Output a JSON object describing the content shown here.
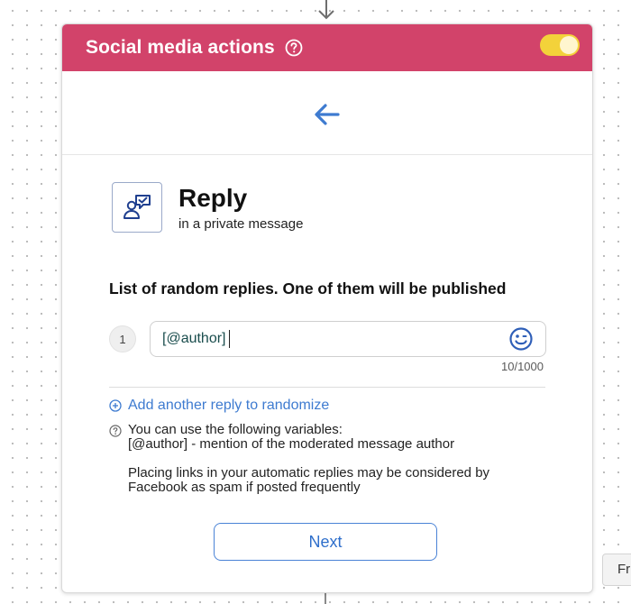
{
  "header": {
    "title": "Social media actions",
    "toggle_on": true,
    "color": "#d2436a",
    "toggle_color": "#f3d23a"
  },
  "nav": {
    "back_icon": "arrow-left-icon"
  },
  "action": {
    "title": "Reply",
    "subtitle": "in a private message",
    "icon": "person-chat-icon"
  },
  "replies": {
    "section_title": "List of random replies. One of them will be published",
    "items": [
      {
        "number": "1",
        "value": "[@author]"
      }
    ],
    "char_count": "10/1000",
    "add_label": "Add another reply to randomize"
  },
  "info": {
    "line1": "You can use the following variables:",
    "line2": "[@author] - mention of the moderated message author",
    "line3": "Placing links in your automatic replies may be considered by",
    "line4": "Facebook as spam if posted frequently"
  },
  "footer": {
    "next_label": "Next"
  },
  "side_chip": {
    "label": "Fr"
  },
  "colors": {
    "accent_blue": "#3e7bd0",
    "header_pink": "#d2436a"
  }
}
